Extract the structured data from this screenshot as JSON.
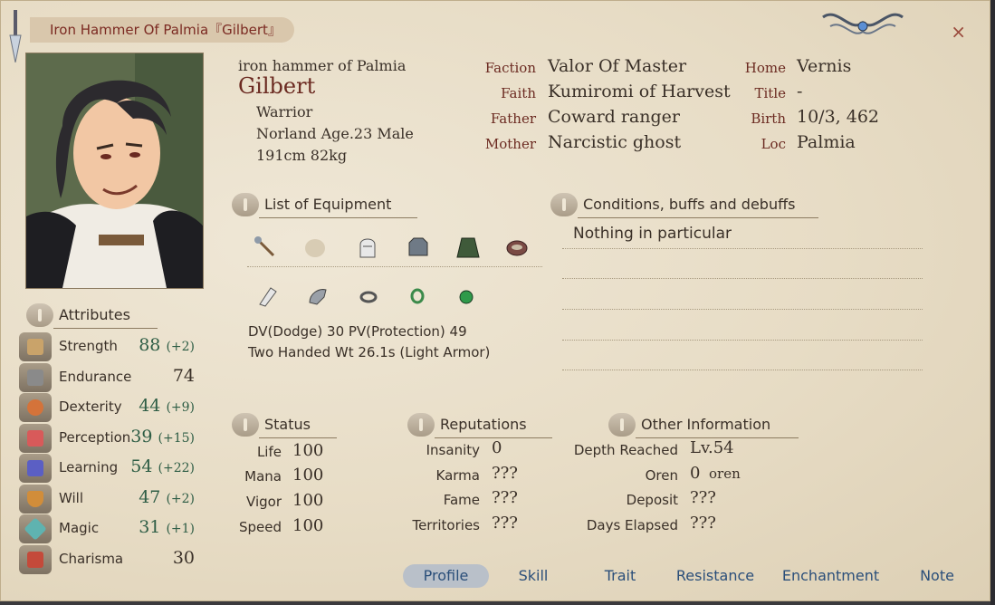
{
  "window": {
    "title": "Iron Hammer Of Palmia『Gilbert』",
    "close_label": "×"
  },
  "profile": {
    "alias": "iron hammer of Palmia",
    "name": "Gilbert",
    "class": "Warrior",
    "race_age_sex": "Norland Age.23 Male",
    "height_weight": "191cm 82kg"
  },
  "bio_mid": {
    "faction_label": "Faction",
    "faction": "Valor Of Master",
    "faith_label": "Faith",
    "faith": "Kumiromi of Harvest",
    "father_label": "Father",
    "father": "Coward ranger",
    "mother_label": "Mother",
    "mother": "Narcistic ghost"
  },
  "bio_right": {
    "home_label": "Home",
    "home": "Vernis",
    "title_label": "Title",
    "title": "-",
    "birth_label": "Birth",
    "birth": "10/3, 462",
    "loc_label": "Loc",
    "loc": "Palmia"
  },
  "equipment": {
    "heading": "List of Equipment",
    "icons_row1": [
      "staff-icon",
      "empty-slot-icon",
      "helmet-icon",
      "chainmail-icon",
      "cloak-icon",
      "belt-icon"
    ],
    "icons_row2": [
      "bracer-icon",
      "gauntlet-icon",
      "ring-icon",
      "ring-icon",
      "amulet-icon"
    ],
    "dv_pv": "DV(Dodge) 30   PV(Protection) 49",
    "style_weight": "Two Handed Wt 26.1s (Light Armor)"
  },
  "conditions": {
    "heading": "Conditions, buffs and debuffs",
    "text": "Nothing in particular"
  },
  "attributes": {
    "heading": "Attributes",
    "items": [
      {
        "label": "Strength",
        "value": "88",
        "bonus": "(+2)",
        "icon": "sword-icon",
        "color": "#c9a36a"
      },
      {
        "label": "Endurance",
        "value": "74",
        "bonus": "",
        "icon": "armor-icon",
        "color": "#8a8a8a"
      },
      {
        "label": "Dexterity",
        "value": "44",
        "bonus": "(+9)",
        "icon": "coin-icon",
        "color": "#d4733a"
      },
      {
        "label": "Perception",
        "value": "39",
        "bonus": "(+15)",
        "icon": "target-icon",
        "color": "#d85a5a"
      },
      {
        "label": "Learning",
        "value": "54",
        "bonus": "(+22)",
        "icon": "book-icon",
        "color": "#5b5fc4"
      },
      {
        "label": "Will",
        "value": "47",
        "bonus": "(+2)",
        "icon": "shield-icon",
        "color": "#d18d3a"
      },
      {
        "label": "Magic",
        "value": "31",
        "bonus": "(+1)",
        "icon": "crystal-icon",
        "color": "#5fb3b0"
      },
      {
        "label": "Charisma",
        "value": "30",
        "bonus": "",
        "icon": "ribbon-icon",
        "color": "#c44a3a"
      }
    ]
  },
  "status": {
    "heading": "Status",
    "rows": [
      {
        "label": "Life",
        "value": "100"
      },
      {
        "label": "Mana",
        "value": "100"
      },
      {
        "label": "Vigor",
        "value": "100"
      },
      {
        "label": "Speed",
        "value": "100"
      }
    ]
  },
  "reputations": {
    "heading": "Reputations",
    "rows": [
      {
        "label": "Insanity",
        "value": "0"
      },
      {
        "label": "Karma",
        "value": "???"
      },
      {
        "label": "Fame",
        "value": "???"
      },
      {
        "label": "Territories",
        "value": "???"
      }
    ]
  },
  "other": {
    "heading": "Other Information",
    "rows": [
      {
        "label": "Depth Reached",
        "value": "Lv.54"
      },
      {
        "label": "Oren",
        "value": "0",
        "unit": "oren"
      },
      {
        "label": "Deposit",
        "value": "???"
      },
      {
        "label": "Days Elapsed",
        "value": "???"
      }
    ]
  },
  "tabs": [
    "Profile",
    "Skill",
    "Trait",
    "Resistance",
    "Enchantment",
    "Note"
  ],
  "active_tab": "Profile"
}
